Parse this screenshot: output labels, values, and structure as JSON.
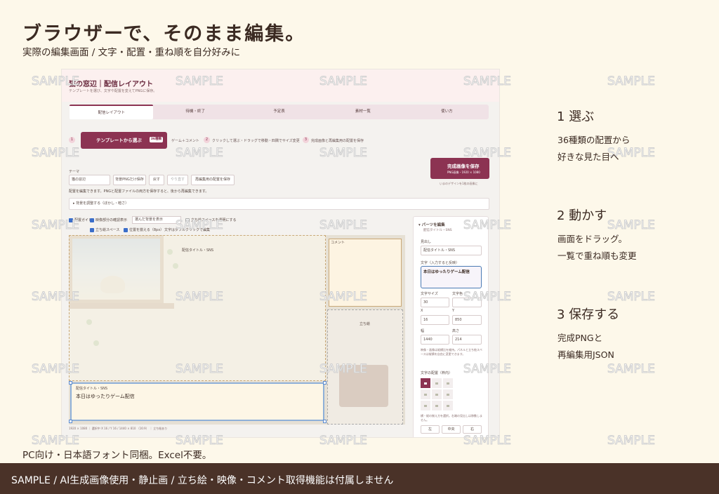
{
  "heading": "ブラウザーで、そのまま編集。",
  "subheading": "実際の編集画面 / 文字・配置・重ね順を自分好みに",
  "screenshot": {
    "app_title": "猫の窓辺｜配信レイアウト",
    "app_desc": "テンプレートを選び、文字や配置を変えてPNGに保存。",
    "tabs": [
      "配信レイアウト",
      "待機・終了",
      "予定表",
      "素材一覧",
      "使い方"
    ],
    "steps": [
      {
        "num": "1",
        "label": ""
      },
      {
        "num": "2",
        "label": "クリックして選ぶ・ドラッグで移動・四隅でサイズ変更"
      },
      {
        "num": "3",
        "label": "完成画像と再編集用の配置を保存"
      }
    ],
    "template_button": "テンプレートから選ぶ",
    "template_badge": "36種類",
    "game_comment_label": "ゲーム＋コメント",
    "save_button": "完成画像を保存",
    "save_button_sub": "PNG画像・1920 × 1080",
    "save_hint": "いまのデザインを1枚の画像に",
    "theme_label": "テーマ",
    "theme_value": "猫の窓辺",
    "buttons": [
      "背景PNGだけ保存",
      "戻す",
      "やり直す",
      "再編集用の配置を保存"
    ],
    "info": "配置を編集できます。PNGと配置ファイルの両方を保存すると、後から再編集できます。",
    "bg_adjust": "▸ 背景を調整する（ぼかし・暗さ）",
    "options": {
      "guide": "配置ガイド",
      "video_check": "映像部分の確認表示",
      "bg_select": "選んだ背景を表示",
      "transparent": "立ち絵スペースを透明にする",
      "stand_ele": "立ち絵スペース",
      "snap": "位置を揃える（8px）",
      "note": "文字はダブルクリックで編集"
    },
    "canvas": {
      "main_label": "配信タイトル・SNS",
      "comment_label": "コメント",
      "stand_label": "立ち絵",
      "title_box_label": "配信タイトル・SNS",
      "title_box_text": "本日はゆったりゲーム配信"
    },
    "canvas_footer": "1920 × 1080 ｜ 選択中 X 16 / Y 16 / 1440 × 810 （16:9） ｜ 立ち絵あり",
    "panel": {
      "title": "▾ パーツを編集",
      "subtitle": "配信タイトル・SNS",
      "heading_label": "見出し",
      "heading_value": "配信タイトル・SNS",
      "text_label": "文字（入力すると反映）",
      "text_value": "本日はゆったりゲーム配信",
      "font_size_label": "文字サイズ",
      "font_size": "30",
      "color_label": "文字色",
      "x_label": "X",
      "x": "16",
      "y_label": "Y",
      "y": "850",
      "w_label": "幅",
      "w": "1440",
      "h_label": "高さ",
      "h": "214",
      "note": "映像・画像は縦横比を維持。パネルと立ち絵スペースは縦横を自由に変更できます。",
      "align_label": "文字の配置（枠内）",
      "align_note": "横・縦の揃え方を選択。右端の見出しは移動しません。",
      "align_buttons": [
        "左",
        "中央",
        "右"
      ]
    }
  },
  "watermark": "SAMPLE",
  "features": [
    {
      "title": "1  選ぶ",
      "lines": [
        "36種類の配置から",
        "好きな見た目へ"
      ]
    },
    {
      "title": "2  動かす",
      "lines": [
        "画面をドラッグ。",
        "一覧で重ね順も変更"
      ]
    },
    {
      "title": "3  保存する",
      "lines": [
        "完成PNGと",
        "再編集用JSON"
      ]
    }
  ],
  "footnote": "PC向け・日本語フォント同梱。Excel不要。",
  "bottom_bar": "SAMPLE / AI生成画像使用・静止画 / 立ち絵・映像・コメント取得機能は付属しません",
  "colors": {
    "accent": "#8c3352",
    "background": "#fdf8ea",
    "bar": "#4a3228"
  }
}
